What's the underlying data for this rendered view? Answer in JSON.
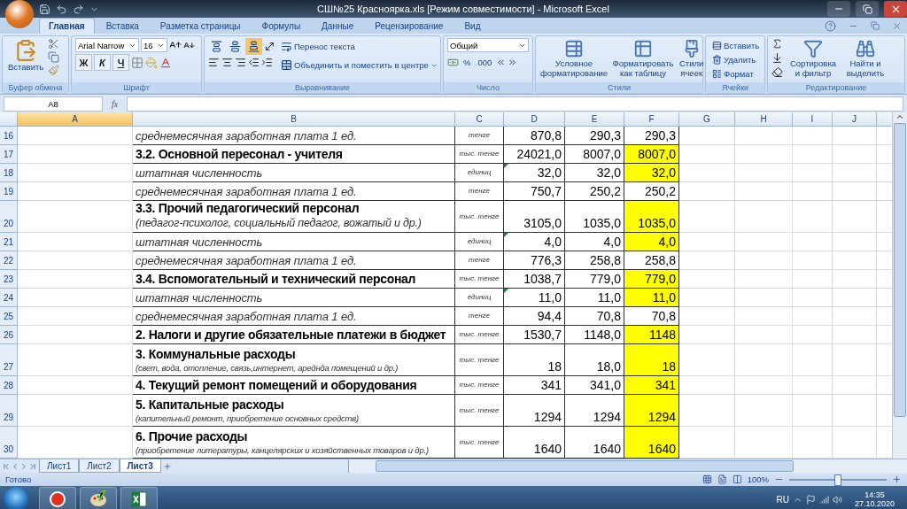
{
  "window": {
    "title": "СШ№25 Красноярка.xls  [Режим совместимости] - Microsoft Excel"
  },
  "ribbon_tabs": [
    {
      "label": "Главная",
      "selected": true
    },
    {
      "label": "Вставка",
      "selected": false
    },
    {
      "label": "Разметка страницы",
      "selected": false
    },
    {
      "label": "Формулы",
      "selected": false
    },
    {
      "label": "Данные",
      "selected": false
    },
    {
      "label": "Рецензирование",
      "selected": false
    },
    {
      "label": "Вид",
      "selected": false
    }
  ],
  "ribbon": {
    "clipboard": {
      "title": "Буфер обмена",
      "paste": "Вставить"
    },
    "font": {
      "title": "Шрифт",
      "name": "Arial Narrow",
      "size": "16",
      "bold": "Ж",
      "italic": "К",
      "underline": "Ч"
    },
    "alignment": {
      "title": "Выравнивание",
      "vertical": [
        {
          "kind": "top",
          "selected": false
        },
        {
          "kind": "middle",
          "selected": false
        },
        {
          "kind": "bottom",
          "selected": true
        }
      ],
      "wrap": "Перенос текста",
      "merge": "Объединить и поместить в центре"
    },
    "number": {
      "title": "Число",
      "format": "Общий",
      "percent": "%",
      "thousands": "000"
    },
    "styles": {
      "title": "Стили",
      "buttons": [
        "Условное форматирование",
        "Форматировать как таблицу",
        "Стили ячеек"
      ]
    },
    "cells": {
      "title": "Ячейки",
      "buttons": [
        "Вставить",
        "Удалить",
        "Формат"
      ]
    },
    "editing": {
      "title": "Редактирование",
      "buttons": [
        "Сортировка и фильтр",
        "Найти и выделить"
      ]
    }
  },
  "formula_bar": {
    "name_box": "A8",
    "fx": "fx"
  },
  "columns": [
    {
      "label": "A",
      "selected": true
    },
    {
      "label": "B",
      "selected": false
    },
    {
      "label": "C",
      "selected": false
    },
    {
      "label": "D",
      "selected": false
    },
    {
      "label": "E",
      "selected": false
    },
    {
      "label": "F",
      "selected": false
    },
    {
      "label": "G",
      "selected": false
    },
    {
      "label": "H",
      "selected": false
    },
    {
      "label": "I",
      "selected": false
    },
    {
      "label": "J",
      "selected": false
    }
  ],
  "rows": [
    {
      "num": "16",
      "kind": "item",
      "label": "среднемесячная заработная плата 1 ед.",
      "unit": "тенге",
      "d": "870,8",
      "e": "290,3",
      "f": "290,3",
      "highlight": false,
      "flag": false
    },
    {
      "num": "17",
      "kind": "head",
      "label": "3.2. Основной пересонал - учителя",
      "unit": "тыс. тенге",
      "d": "24021,0",
      "e": "8007,0",
      "f": "8007,0",
      "highlight": true,
      "flag": false
    },
    {
      "num": "18",
      "kind": "item",
      "label": "штатная численность",
      "unit": "единиц",
      "d": "32,0",
      "e": "32,0",
      "f": "32,0",
      "highlight": true,
      "flag": true
    },
    {
      "num": "19",
      "kind": "item",
      "label": "среднемесячная заработная плата 1 ед.",
      "unit": "тенге",
      "d": "750,7",
      "e": "250,2",
      "f": "250,2",
      "highlight": false,
      "flag": false
    },
    {
      "num": "20",
      "kind": "group",
      "label": "3.3. Прочий педагогический персонал",
      "note": "(педагог-психолог, социальный педагог, вожатый и др.)",
      "note_small": false,
      "unit": "тыс. тенге",
      "d": "3105,0",
      "e": "1035,0",
      "f": "1035,0",
      "highlight": true,
      "flag": false
    },
    {
      "num": "21",
      "kind": "item",
      "label": "штатная численность",
      "unit": "единиц",
      "d": "4,0",
      "e": "4,0",
      "f": "4,0",
      "highlight": true,
      "flag": true
    },
    {
      "num": "22",
      "kind": "item",
      "label": "среднемесячная заработная плата 1 ед.",
      "unit": "тенге",
      "d": "776,3",
      "e": "258,8",
      "f": "258,8",
      "highlight": false,
      "flag": false
    },
    {
      "num": "23",
      "kind": "head",
      "label": "3.4. Вспомогательный и технический персонал",
      "unit": "тыс. тенге",
      "d": "1038,7",
      "e": "779,0",
      "f": "779,0",
      "highlight": true,
      "flag": false
    },
    {
      "num": "24",
      "kind": "item",
      "label": "штатная численность",
      "unit": "единиц",
      "d": "11,0",
      "e": "11,0",
      "f": "11,0",
      "highlight": true,
      "flag": true
    },
    {
      "num": "25",
      "kind": "item",
      "label": "среднемесячная заработная плата 1 ед.",
      "unit": "тенге",
      "d": "94,4",
      "e": "70,8",
      "f": "70,8",
      "highlight": false,
      "flag": false
    },
    {
      "num": "26",
      "kind": "head",
      "label": "2. Налоги и другие обязательные платежи в бюджет",
      "unit": "тыс. тенге",
      "d": "1530,7",
      "e": "1148,0",
      "f": "1148",
      "highlight": true,
      "flag": false
    },
    {
      "num": "27",
      "kind": "group",
      "label": "3. Коммунальные расходы",
      "note": "(свет, вода, отопление, связь,интернет, ареднда помещений и др.)",
      "note_small": true,
      "unit": "тыс. тенге",
      "d": "18",
      "e": "18,0",
      "f": "18",
      "highlight": true,
      "flag": false
    },
    {
      "num": "28",
      "kind": "head",
      "label": "4. Текущий ремонт помещений и оборудования",
      "unit": "тыс. тенге",
      "d": "341",
      "e": "341,0",
      "f": "341",
      "highlight": true,
      "flag": false
    },
    {
      "num": "29",
      "kind": "group",
      "label": "5. Капитальные расходы",
      "note": "(капительный ремонт, приобретение основных средств)",
      "note_small": true,
      "unit": "тыс. тенге",
      "d": "1294",
      "e": "1294",
      "f": "1294",
      "highlight": true,
      "flag": false
    },
    {
      "num": "30",
      "kind": "group",
      "label": "6. Прочие расходы",
      "note": "(приобретение литературы, канцелярских и хозяйственных товаров и др.)",
      "note_small": true,
      "unit": "тыс. тенге",
      "d": "1640",
      "e": "1640",
      "f": "1640",
      "highlight": true,
      "flag": false
    }
  ],
  "sheets": [
    {
      "label": "Лист1",
      "selected": false
    },
    {
      "label": "Лист2",
      "selected": false
    },
    {
      "label": "Лист3",
      "selected": true
    }
  ],
  "status": {
    "text": "Готово",
    "zoom": "100%",
    "level": 0.5
  },
  "taskbar": {
    "apps": [
      {
        "kind": "browser"
      },
      {
        "kind": "paint"
      },
      {
        "kind": "sheet"
      }
    ],
    "lang": "RU",
    "time": "14:35",
    "date": "27.10.2020"
  }
}
